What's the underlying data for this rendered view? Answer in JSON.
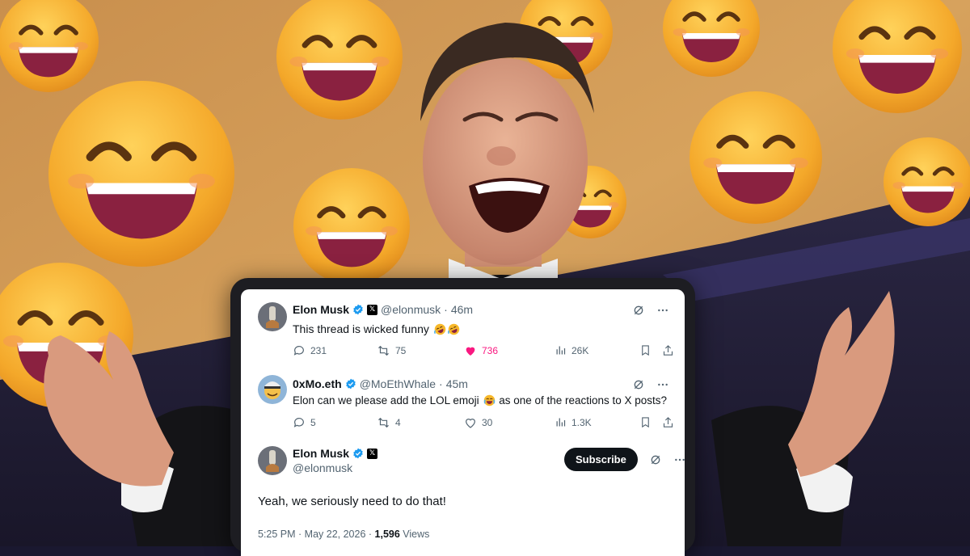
{
  "posts": [
    {
      "display_name": "Elon Musk",
      "handle": "@elonmusk",
      "time": "46m",
      "text": "This thread is wicked funny",
      "reply_count": "231",
      "repost_count": "75",
      "like_count": "736",
      "view_count": "26K",
      "liked": true,
      "inline_emoji": [
        "rofl-emoji",
        "rofl-emoji"
      ]
    },
    {
      "display_name": "0xMo.eth",
      "handle": "@MoEthWhale",
      "time": "45m",
      "text_before": "Elon can we please add the LOL emoji",
      "text_after": "as one of the reactions to X posts?",
      "reply_count": "5",
      "repost_count": "4",
      "like_count": "30",
      "view_count": "1.3K",
      "liked": false,
      "inline_emoji": [
        "tears-of-joy-emoji"
      ]
    }
  ],
  "main_post": {
    "display_name": "Elon Musk",
    "handle": "@elonmusk",
    "subscribe_label": "Subscribe",
    "text": "Yeah, we seriously need to do that!",
    "timestamp": "5:25 PM · May 22, 2026 · ",
    "views_count": "1,596",
    "views_label": "Views"
  },
  "separator": "·",
  "colors": {
    "verified_blue": "#1d9bf0",
    "like_pink": "#f91880",
    "text_primary": "#0f1419",
    "text_secondary": "#536471",
    "emoji_yellow": "#f7b82a"
  }
}
